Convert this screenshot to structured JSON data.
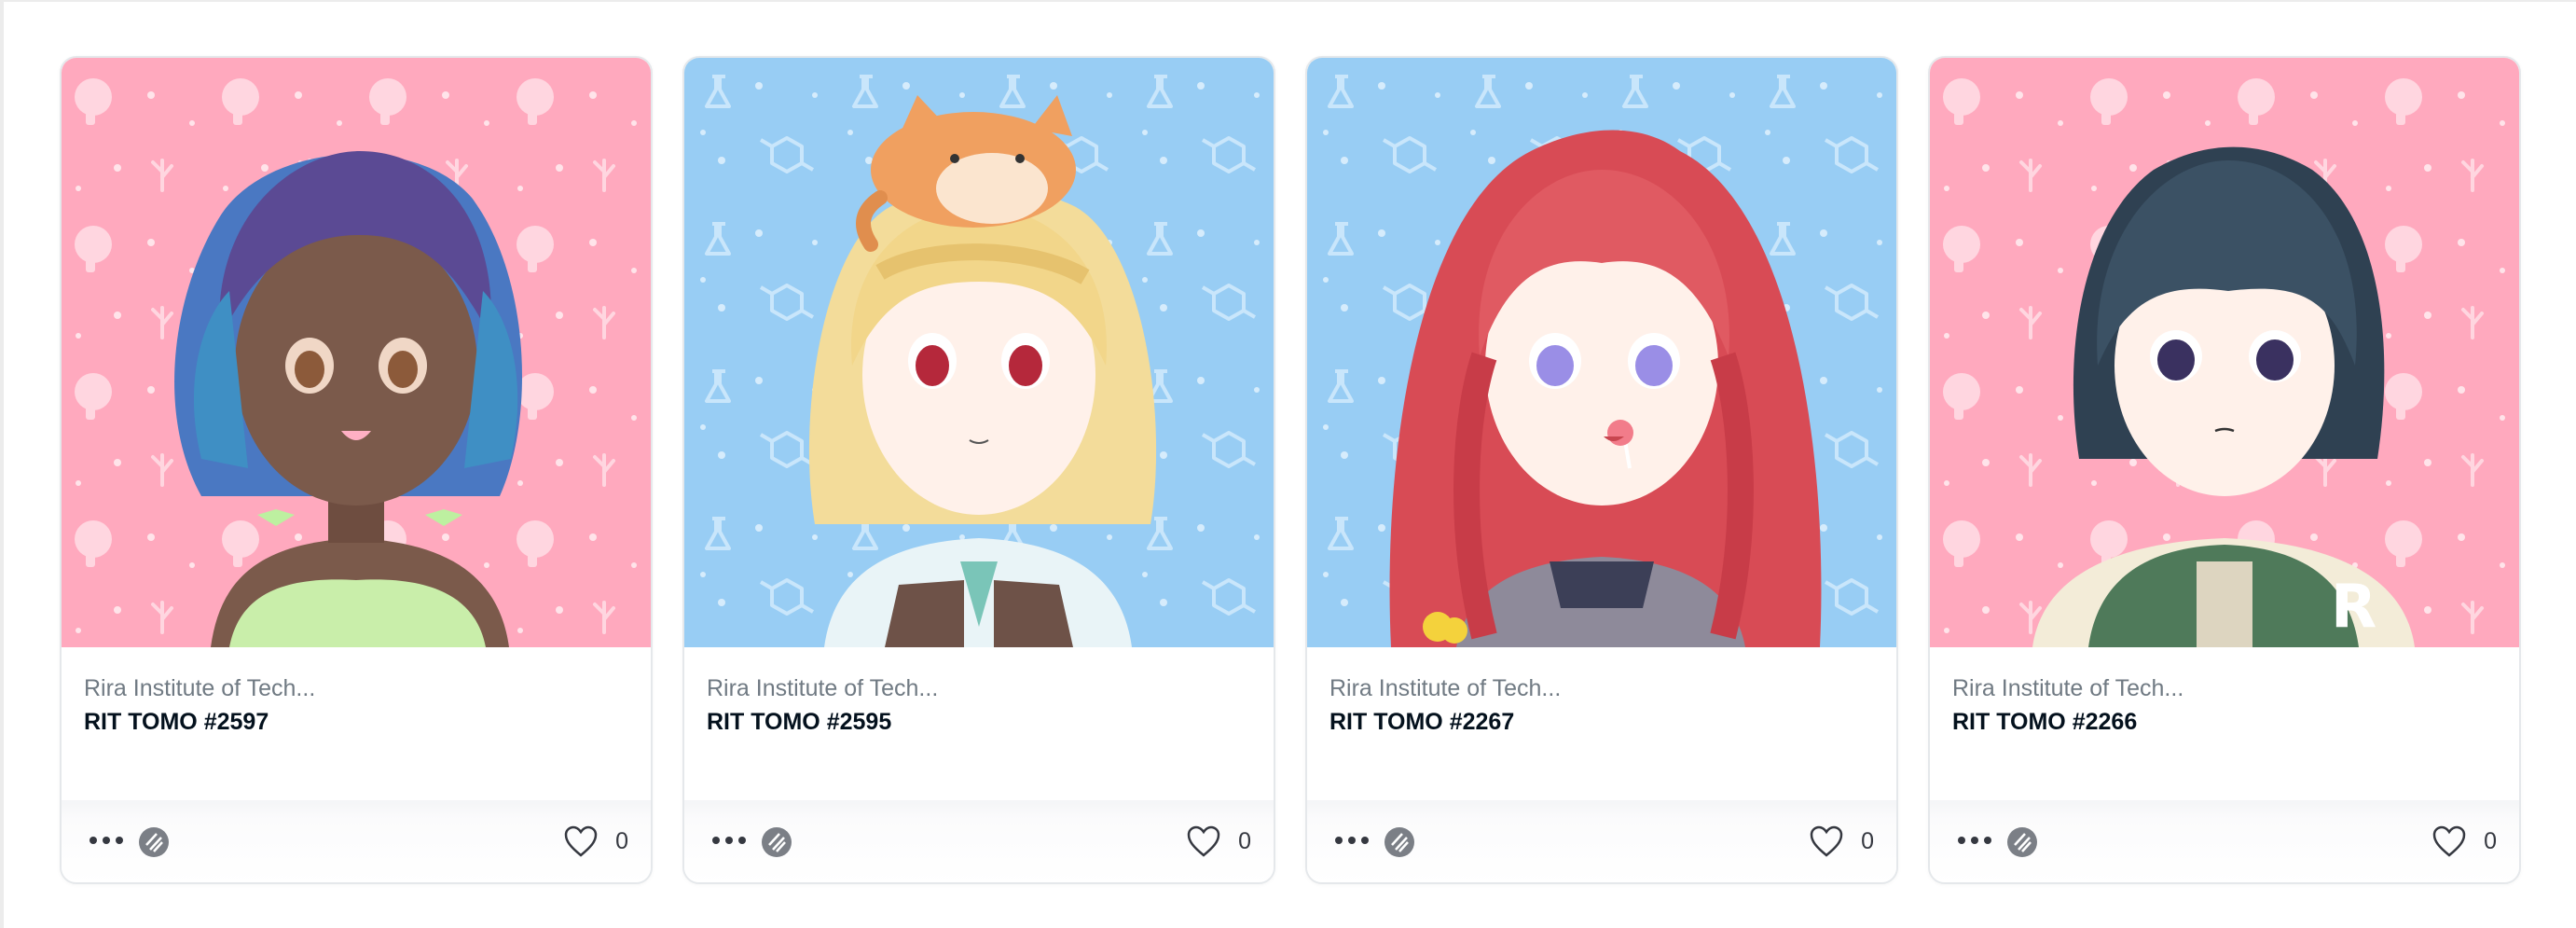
{
  "cards": [
    {
      "collection": "Rira Institute of Tech...",
      "name": "RIT TOMO #2597",
      "likes": "0",
      "background": "pink"
    },
    {
      "collection": "Rira Institute of Tech...",
      "name": "RIT TOMO #2595",
      "likes": "0",
      "background": "blue"
    },
    {
      "collection": "Rira Institute of Tech...",
      "name": "RIT TOMO #2267",
      "likes": "0",
      "background": "blue"
    },
    {
      "collection": "Rira Institute of Tech...",
      "name": "RIT TOMO #2266",
      "likes": "0",
      "background": "pink"
    }
  ],
  "icons": {
    "more": "more-options-icon",
    "chain": "ethereum-chain-icon",
    "like": "heart-icon"
  },
  "colors": {
    "pink_bg": "#ffa9be",
    "blue_bg": "#98cdf4",
    "border": "#e5e8eb",
    "text_muted": "#707a83",
    "text_main": "#04111d"
  }
}
